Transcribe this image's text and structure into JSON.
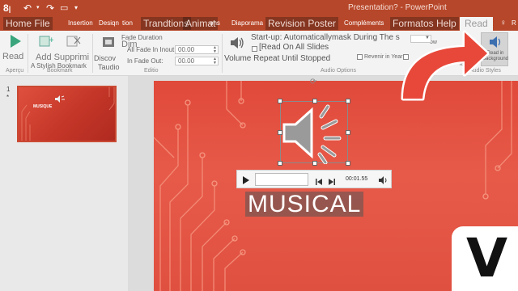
{
  "quick_access": {
    "save_badge": "8",
    "undo_label": "↶",
    "redo_label": "↷"
  },
  "app_title": "Presentation? - PowerPoint",
  "tabs": [
    {
      "label": "Home File",
      "style": "big"
    },
    {
      "label": "Insertion",
      "style": "small"
    },
    {
      "label": "Desiqn",
      "style": "small"
    },
    {
      "label": "tion",
      "style": "small"
    },
    {
      "label": "Trandtions",
      "style": "big"
    },
    {
      "label": "Animat",
      "style": "big"
    },
    {
      "label": "ons",
      "style": "small"
    },
    {
      "label": "Diaporama",
      "style": "small"
    },
    {
      "label": "Revision Poster",
      "style": "big"
    },
    {
      "label": "Compléments",
      "style": "small"
    },
    {
      "label": "Formatos Help",
      "style": "big"
    },
    {
      "label": "Read",
      "style": "active"
    },
    {
      "label": "R",
      "style": "small"
    }
  ],
  "ribbon": {
    "play": {
      "label": "Read",
      "group": "Aperçu"
    },
    "bookmark": {
      "add_label": "Add Supprimi",
      "sublabel": "A Stylish Bookmark",
      "group": "Bookmark"
    },
    "editing": {
      "discover_label": "Discov",
      "taudio_label": "Taudio",
      "dim_label": "Dim",
      "fade_title": "Fade Duration",
      "fade_in_label": "All Fade In Inout:",
      "fade_in_value": "00.00",
      "fade_out_label": "In Fade Out:",
      "fade_out_value": "00.00",
      "group": "Editio"
    },
    "audio_options": {
      "start_label": "Start-up: Automaticallymask During The s",
      "start_suffix": "ow",
      "read_all_label": "[Read On All Slides",
      "volume_label": "Volume Repeat Until Stopped",
      "rewind_label": "Revenir in Year",
      "group": "Audio Options"
    },
    "audio_styles": {
      "style_label": "le",
      "read_bg_label": "Read in Background",
      "group": "Audio Styles"
    }
  },
  "slides": [
    {
      "number": "1",
      "marker": "*",
      "title": "MUSIQUE"
    }
  ],
  "player": {
    "time": "00:01.55",
    "progress": 0.0
  },
  "slide": {
    "title": "MUSICAL"
  },
  "watermark": {
    "letter": "V"
  },
  "colors": {
    "accent": "#b7472a",
    "slide_red": "#e54f40",
    "arrow": "#e8483a"
  }
}
